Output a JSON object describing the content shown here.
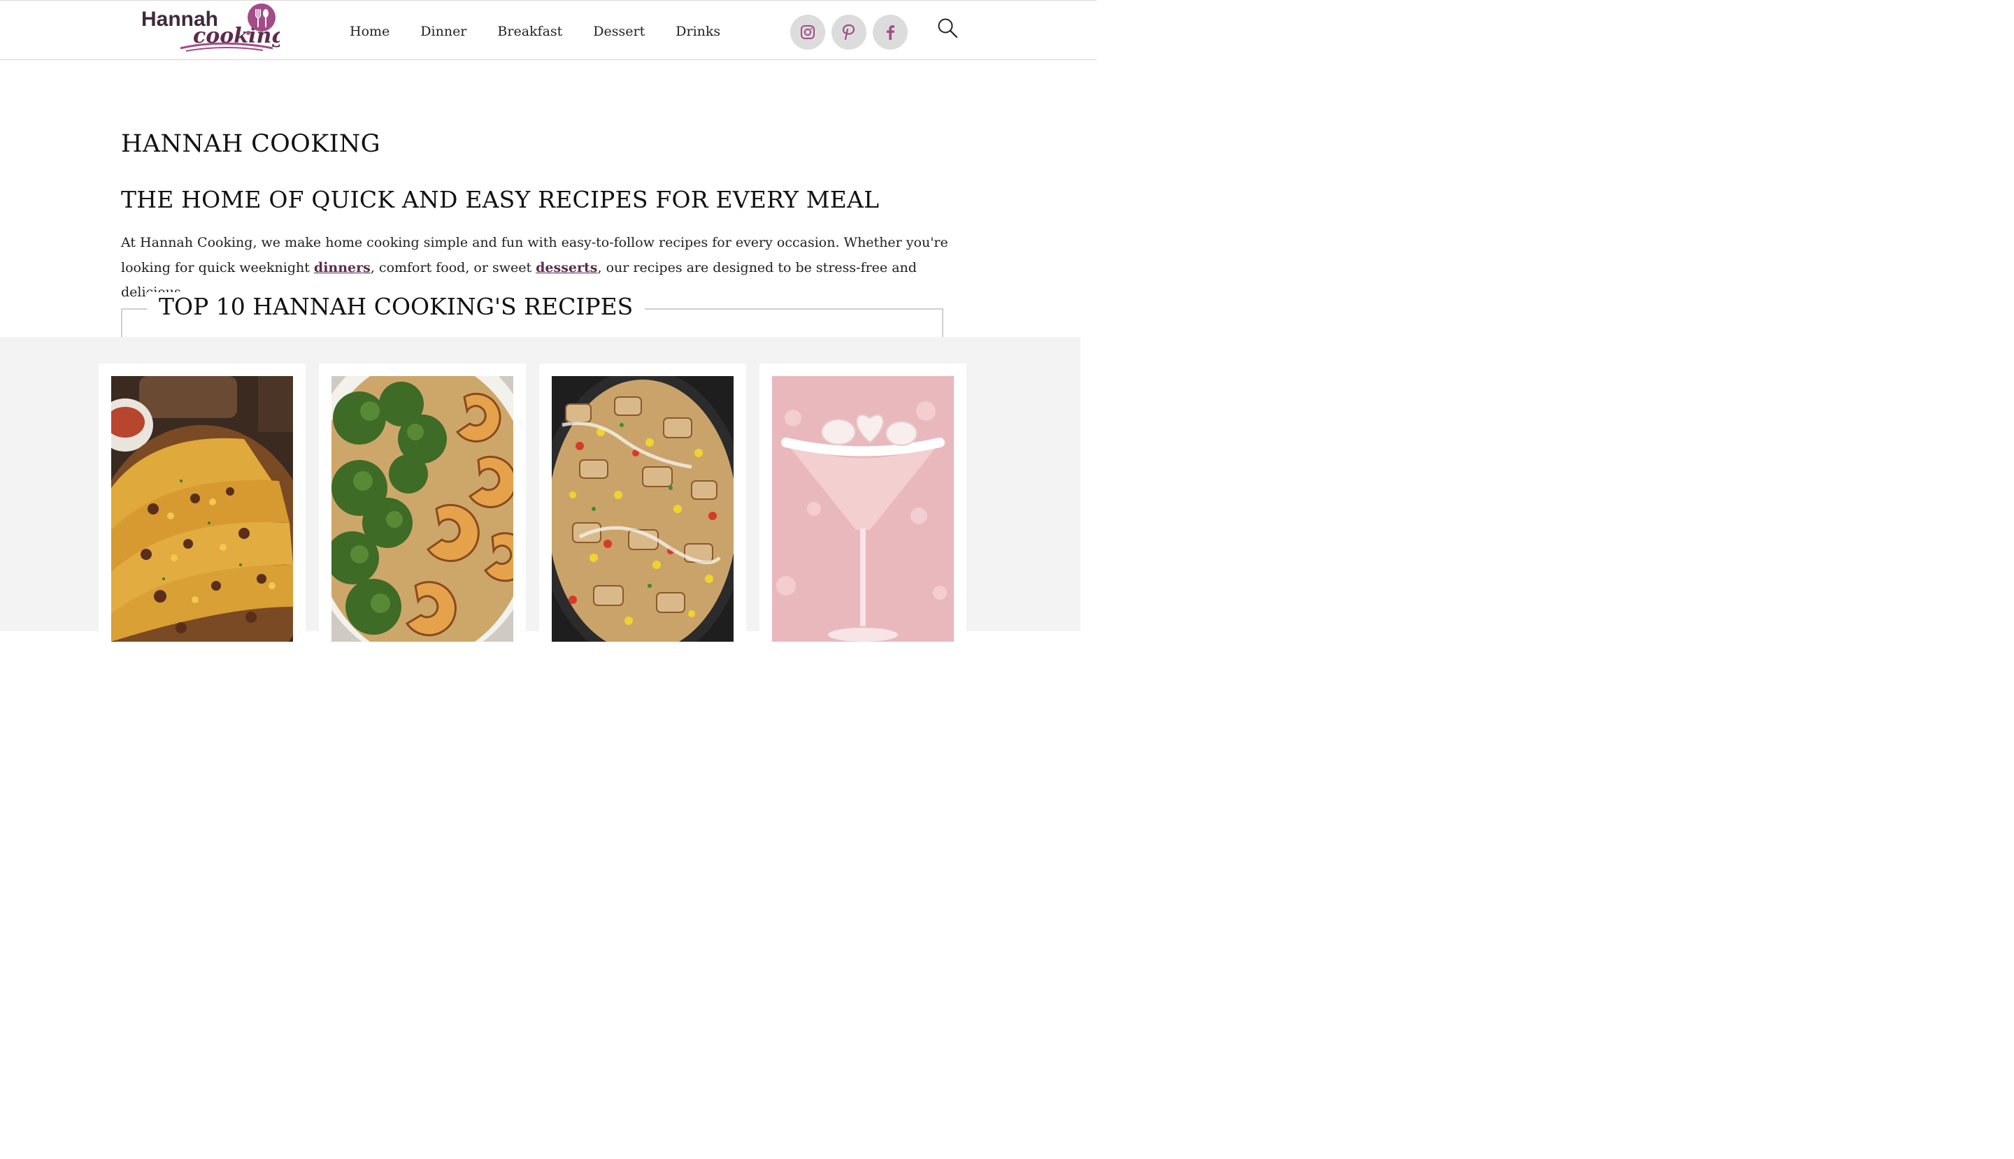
{
  "header": {
    "logo": {
      "line1": "Hannah",
      "line2": "cooking"
    },
    "nav": [
      {
        "label": "Home"
      },
      {
        "label": "Dinner"
      },
      {
        "label": "Breakfast"
      },
      {
        "label": "Dessert"
      },
      {
        "label": "Drinks"
      }
    ],
    "socials": [
      {
        "icon": "instagram-icon"
      },
      {
        "icon": "pinterest-icon"
      },
      {
        "icon": "facebook-icon"
      }
    ],
    "search_icon": "search-icon"
  },
  "intro": {
    "site_title": "HANNAH COOKING",
    "tagline": "THE HOME OF QUICK AND EASY RECIPES FOR EVERY MEAL",
    "text_part1": "At Hannah Cooking, we make home cooking simple and fun with easy-to-follow recipes for every occasion. Whether you're looking for quick weeknight ",
    "link_dinners": "dinners",
    "text_part2": ", comfort food, or sweet ",
    "link_desserts": "desserts",
    "text_part3": ", our recipes are designed to be stress-free and delicious."
  },
  "top_recipes": {
    "heading": "TOP 10 HANNAH COOKING'S RECIPES"
  },
  "colors": {
    "brand_purple": "#5b2c4c",
    "logo_pink": "#a24d87",
    "social_bg": "#dcdcdc",
    "cards_bg": "#f3f3f3"
  }
}
